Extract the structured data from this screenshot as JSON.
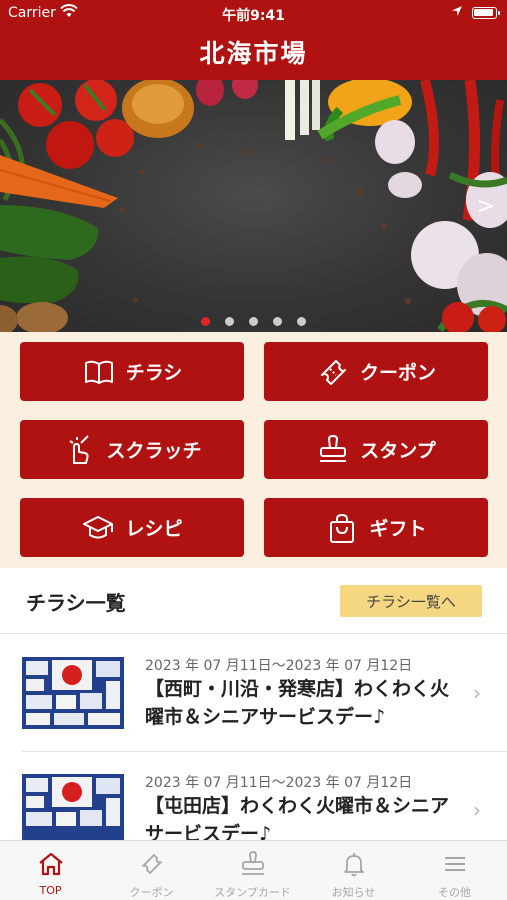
{
  "status_bar": {
    "carrier": "Carrier",
    "time": "午前9:41"
  },
  "header": {
    "title": "北海市場"
  },
  "banner": {
    "slide_count": 5,
    "active_slide": 1,
    "next_arrow": ">"
  },
  "menu": {
    "buttons": [
      {
        "label": "チラシ",
        "icon": "book-icon"
      },
      {
        "label": "クーポン",
        "icon": "ticket-icon"
      },
      {
        "label": "スクラッチ",
        "icon": "hand-tap-icon"
      },
      {
        "label": "スタンプ",
        "icon": "stamp-icon"
      },
      {
        "label": "レシピ",
        "icon": "graduation-cap-icon"
      },
      {
        "label": "ギフト",
        "icon": "shopping-bag-icon"
      }
    ]
  },
  "flyers": {
    "title": "チラシ一覧",
    "more_label": "チラシ一覧へ",
    "items": [
      {
        "date": "2023 年 07 月11日～2023 年 07 月12日",
        "name": "【西町・川沿・発寒店】わくわく火曜市＆シニアサービスデー♪"
      },
      {
        "date": "2023 年 07 月11日～2023 年 07 月12日",
        "name": "【屯田店】わくわく火曜市＆シニアサービスデー♪"
      }
    ]
  },
  "tabbar": {
    "tabs": [
      {
        "label": "TOP",
        "icon": "home-icon",
        "active": true
      },
      {
        "label": "クーポン",
        "icon": "ticket-icon",
        "active": false
      },
      {
        "label": "スタンプカード",
        "icon": "stamp-icon",
        "active": false
      },
      {
        "label": "お知らせ",
        "icon": "bell-icon",
        "active": false
      },
      {
        "label": "その他",
        "icon": "list-icon",
        "active": false
      }
    ]
  },
  "colors": {
    "brand_red": "#b01212",
    "menu_background": "#fcefe0",
    "more_button": "#f6d781",
    "tab_inactive": "#a6a6a6"
  }
}
